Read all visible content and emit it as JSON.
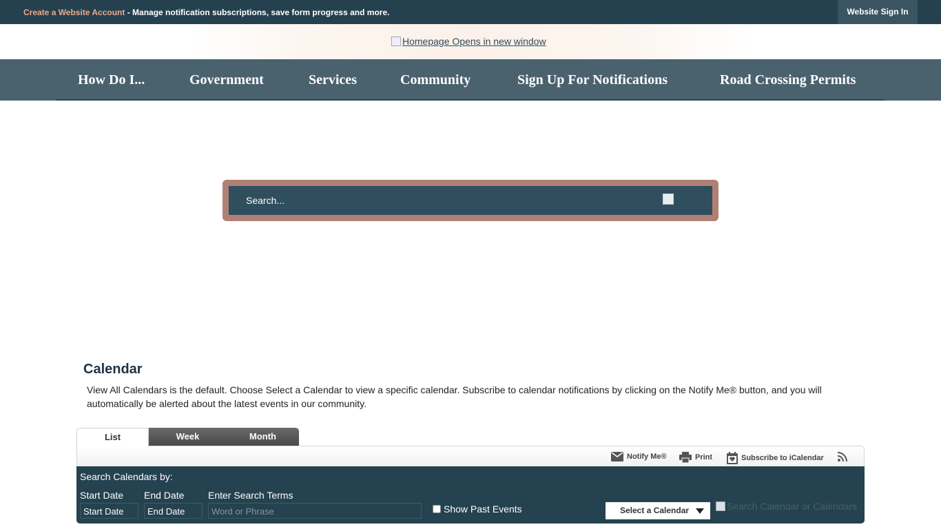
{
  "topbar": {
    "create_link": "Create a Website Account",
    "create_desc": " - Manage notification subscriptions, save form progress and more.",
    "sign_in": "Website Sign In"
  },
  "header": {
    "logo_alt": "Homepage Opens in new window"
  },
  "nav": {
    "items": [
      {
        "label": "How Do I..."
      },
      {
        "label": "Government"
      },
      {
        "label": "Services"
      },
      {
        "label": "Community"
      },
      {
        "label": "Sign Up For Notifications"
      },
      {
        "label": "Road Crossing Permits"
      }
    ]
  },
  "search": {
    "placeholder": "Search..."
  },
  "calendar": {
    "title": "Calendar",
    "description": "View All Calendars is the default. Choose Select a Calendar to view a specific calendar. Subscribe to calendar notifications by clicking on the Notify Me® button, and you will automatically be alerted about the latest events in our community.",
    "tabs": [
      {
        "label": "List",
        "active": true
      },
      {
        "label": "Week",
        "active": false
      },
      {
        "label": "Month",
        "active": false
      }
    ],
    "tools": {
      "notify": "Notify Me®",
      "print": "Print",
      "subscribe": "Subscribe to iCalendar",
      "rss_icon": "rss-icon"
    },
    "panel": {
      "heading": "Search Calendars by:",
      "start_label": "Start Date",
      "start_value": "Start Date",
      "end_label": "End Date",
      "end_value": "End Date",
      "terms_label": "Enter Search Terms",
      "terms_placeholder": "Word or Phrase",
      "past_events": "Show Past Events",
      "select_calendar": "Select a Calendar",
      "search_alt": "Search Calendar or Calendars"
    }
  },
  "colors": {
    "topbar": "#25404f",
    "nav": "#4a626e",
    "search_frame": "#b08074",
    "search_inner": "#2f4f5e",
    "panel": "#24424f",
    "accent_link": "#f0a98a"
  }
}
